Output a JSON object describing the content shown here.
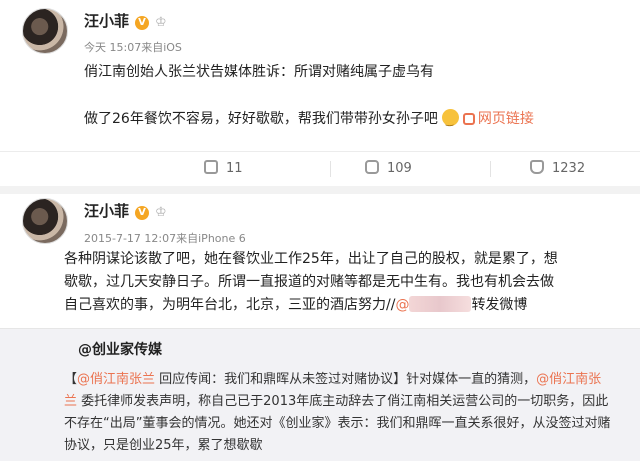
{
  "post1": {
    "author": "汪小菲",
    "badge": "V",
    "time": "今天 15:07",
    "source": "来自iOS",
    "text1": "俏江南创始人张兰状告媒体胜诉：所谓对赌纯属子虚乌有",
    "text2": "做了26年餐饮不容易，好好歇歇，帮我们带带孙女孙子吧",
    "link_label": "网页链接",
    "repost_count": "11",
    "comment_count": "109",
    "like_count": "1232"
  },
  "post2": {
    "author": "汪小菲",
    "badge": "V",
    "time": "2015-7-17 12:07",
    "source": "来自iPhone 6",
    "line1": "各种阴谋论该散了吧，她在餐饮业工作25年，出让了自己的股权，就是累了，想",
    "line2": "歇歇，过几天安静日子。所谓一直报道的对赌等都是无中生有。我也有机会去做",
    "line3a": "自己喜欢的事，为明年台北，北京，三亚的酒店努力//",
    "line3b": "@",
    "line3c": "转发微博"
  },
  "quote": {
    "source": "@创业家传媒",
    "l1_prefix": "【",
    "l1_mention": "@俏江南张兰",
    "l1_mid": " 回应传闻：我们和鼎晖从未签过对赌协议】针对媒体一直的猜测，",
    "l1_mention2": "@俏江南张",
    "l2_mention_end": "兰",
    "l2_rest": " 委托律师发表声明，称自己已于2013年底主动辞去了俏江南相关运营公司的一切职务，因此",
    "l3": "不存在“出局”董事会的情况。她还对《创业家》表示：我们和鼎晖一直关系很好，从没签过对赌",
    "l4": "协议，只是创业25年，累了想歇歇"
  }
}
